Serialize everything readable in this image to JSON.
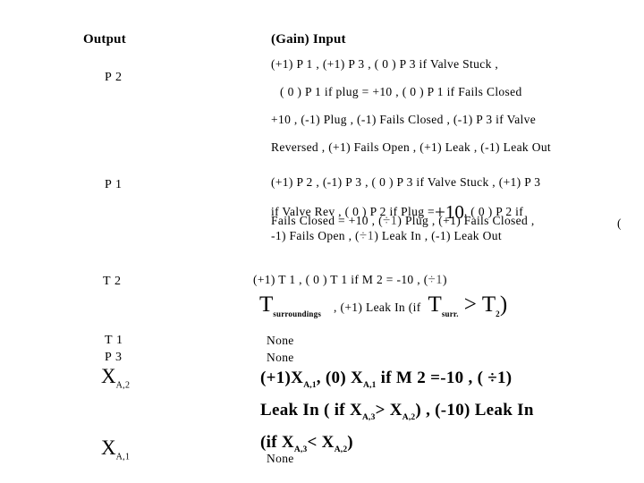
{
  "header": {
    "output_label": "Output",
    "input_label": "(Gain) Input"
  },
  "rows": [
    {
      "output": "P 2",
      "input_lines": [
        "(+1) P 1 , (+1) P 3 , ( 0 ) P 3  if  Valve  Stuck ,",
        "( 0 ) P 1  if  plug = +10 , ( 0 ) P 1  if  Fails  Closed",
        "+10 , (-1) Plug , (-1) Fails  Closed , (-1) P 3  if  Valve",
        "Reversed , (+1) Fails  Open , (+1) Leak , (-1) Leak  Out"
      ]
    },
    {
      "output": "P 1",
      "input_lines": [
        "(+1) P 2 , (-1) P 3 , ( 0 ) P 3  if  Valve  Stuck , (+1) P 3",
        "if  Valve  Rev , ( 0 ) P 2  if  Plug =",
        "+10",
        ", ( 0 ) P 2  if",
        "Fails  Closed = +10 , (",
        "÷1",
        ")  Plug , (+1) Fails  Closed ,",
        "(",
        "-1) Fails  Open , (",
        "÷1",
        ") Leak  In , (-1) Leak  Out"
      ]
    },
    {
      "output": "T 2",
      "input_lines": [
        "(+1) T 1 , ( 0 ) T 1  if  M 2 = -10 , (",
        "÷1",
        ")",
        "T",
        "surroundings",
        ", (+1) Leak  In  (if",
        "T",
        "surr.",
        ">",
        "T",
        "2",
        ")"
      ]
    },
    {
      "output": "T 1",
      "input_lines": [
        "None"
      ]
    },
    {
      "output": "P 3",
      "input_lines": [
        "None"
      ]
    },
    {
      "output": "X",
      "output_sub": "A,2",
      "input_lines": [
        "(+1)X",
        "A,1",
        ",  (0)  X",
        "A,1",
        "  if   M 2 =-10 , ( ÷1)",
        "Leak  In  ( if X",
        "A,3",
        ">  X",
        "A,2",
        ") , (-10) Leak  In",
        "(if  X",
        "A,3",
        "<  X",
        "A,2",
        ")"
      ]
    },
    {
      "output": "X",
      "output_sub": "A,1",
      "input_lines": [
        "None"
      ]
    }
  ],
  "p2_block": {
    "line1": "(+1) P 1 , (+1) P 3 , ( 0 ) P 3  if  Valve  Stuck ,",
    "line2": "( 0 ) P 1  if  plug = +10 , ( 0 ) P 1  if  Fails  Closed",
    "line3": "+10 , (-1) Plug , (-1) Fails  Closed , (-1) P 3  if  Valve",
    "line4": "Reversed , (+1) Fails  Open , (+1) Leak , (-1) Leak  Out"
  },
  "p1_block": {
    "line1": "(+1) P 2 , (-1) P 3 , ( 0 ) P 3  if  Valve  Stuck , (+1) P 3",
    "line2_a": "if  Valve  Rev , ( 0 ) P 2  if  Plug =",
    "line2_big": "+10",
    "line2_b": ", ( 0 ) P 2  if",
    "line3_a": "Fails  Closed = +10 , (",
    "line3_div": "÷1",
    "line3_b": ")  Plug , (+1) Fails  Closed ,",
    "line3_stray": "(",
    "line4_a": "-1) Fails  Open , (",
    "line4_div": "÷1",
    "line4_b": ") Leak  In , (-1) Leak  Out"
  },
  "t2_block": {
    "line1_a": "(+1) T 1 , ( 0 ) T 1  if  M 2 = -10 , (",
    "line1_div": "÷1",
    "line1_b": ")",
    "t_main": "T",
    "t_sub": "surroundings",
    "line2_mid": ", (+1) Leak  In   (if",
    "t2_main": "T",
    "t2_sub": "surr.",
    "gt": ">",
    "t3_main": "T",
    "t3_sub": "2",
    "close_paren": ")"
  },
  "xa_block": {
    "seg1": "(+1)X",
    "sub1": "A,1",
    "seg2": ",  (0)  X",
    "sub2": "A,1",
    "seg3": "  if   M 2 =-10 , ( ÷1)",
    "seg4": "Leak  In  ( if X",
    "sub3": "A,3",
    "seg5": ">  X",
    "sub4": "A,2",
    "seg6": ") , (-10) Leak  In",
    "seg7": "(if  X",
    "sub5": "A,3",
    "seg8": "<  X",
    "sub6": "A,2",
    "seg9": ")"
  },
  "none_values": {
    "t1": "None",
    "p3": "None",
    "xa1": "None"
  },
  "labels": {
    "p2": "P 2",
    "p1": "P 1",
    "t2": "T 2",
    "t1": "T 1",
    "p3": "P 3",
    "x_main": "X",
    "xa2_sub": "A,2",
    "xa1_sub": "A,1"
  },
  "colors": {
    "background": "#ffffff",
    "text": "#000000",
    "muted": "#4a4a4a"
  }
}
